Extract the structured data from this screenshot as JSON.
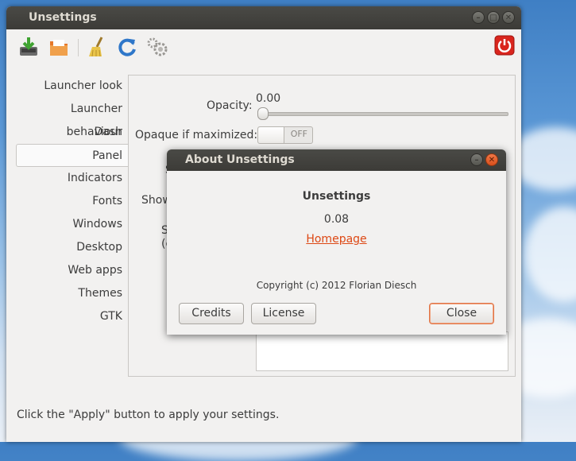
{
  "main_window": {
    "title": "Unsettings",
    "window_buttons": {
      "minimize": "–",
      "maximize": "□",
      "close": "✕"
    },
    "toolbar": [
      "save-icon",
      "folder-icon",
      "broom-icon",
      "refresh-icon",
      "gears-icon",
      "power-icon"
    ],
    "sidebar": {
      "items": [
        {
          "label": "Launcher look"
        },
        {
          "label": "Launcher behaviour"
        },
        {
          "label": "Dash"
        },
        {
          "label": "Panel",
          "active": true
        },
        {
          "label": "Indicators"
        },
        {
          "label": "Fonts"
        },
        {
          "label": "Windows"
        },
        {
          "label": "Desktop"
        },
        {
          "label": "Web apps"
        },
        {
          "label": "Themes"
        },
        {
          "label": "GTK"
        }
      ]
    },
    "panel": {
      "opacity_label": "Opacity:",
      "opacity_value": "0.00",
      "opacity_level": 0.0,
      "opaque_label": "Opaque if maximized:",
      "opaque_state": "OFF",
      "partial_labels": [
        "S",
        "Show",
        "S",
        "(c"
      ]
    },
    "status": "Click the \"Apply\" button to apply your settings."
  },
  "about_dialog": {
    "title": "About Unsettings",
    "window_buttons": {
      "minimize": "–",
      "close": "✕"
    },
    "app_name": "Unsettings",
    "version": "0.08",
    "homepage": "Homepage",
    "copyright": "Copyright (c) 2012 Florian Diesch",
    "buttons": {
      "credits": "Credits",
      "license": "License",
      "close": "Close"
    }
  },
  "colors": {
    "accent": "#dd4814",
    "titlebar": "#3c3b37",
    "window_bg": "#f2f1f0"
  }
}
